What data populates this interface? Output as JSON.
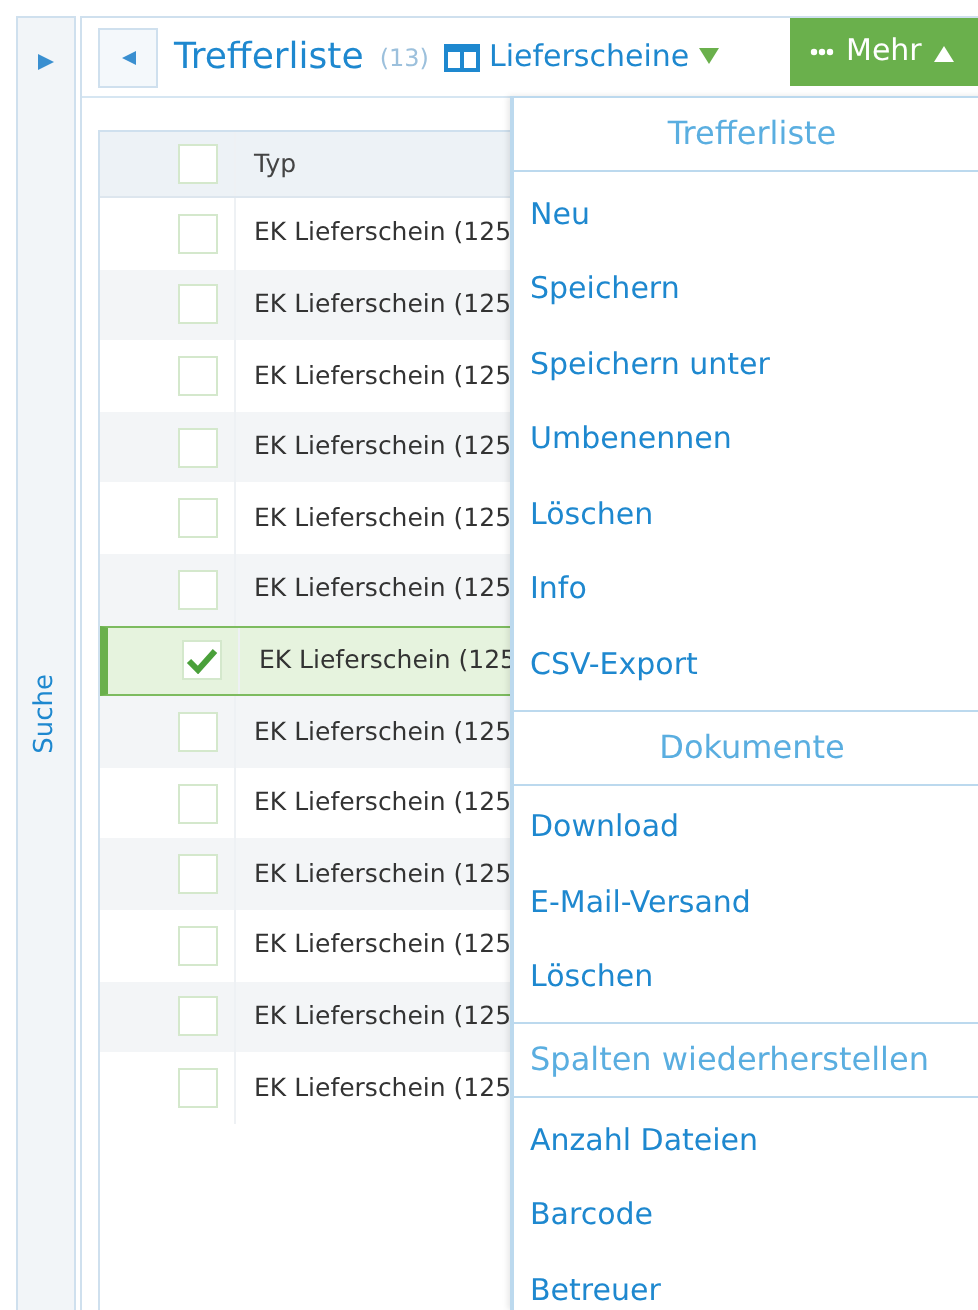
{
  "sidebar": {
    "label": "Suche"
  },
  "header": {
    "title": "Trefferliste",
    "count": "(13)",
    "view": "Lieferscheine",
    "more_button": "Mehr"
  },
  "table": {
    "columns": [
      "Typ"
    ],
    "header_checked": false,
    "rows": [
      {
        "typ": "EK Lieferschein (125",
        "selected": false
      },
      {
        "typ": "EK Lieferschein (125",
        "selected": false
      },
      {
        "typ": "EK Lieferschein (125",
        "selected": false
      },
      {
        "typ": "EK Lieferschein (125",
        "selected": false
      },
      {
        "typ": "EK Lieferschein (125",
        "selected": false
      },
      {
        "typ": "EK Lieferschein (125",
        "selected": false
      },
      {
        "typ": "EK Lieferschein (125",
        "selected": true
      },
      {
        "typ": "EK Lieferschein (125",
        "selected": false
      },
      {
        "typ": "EK Lieferschein (125",
        "selected": false
      },
      {
        "typ": "EK Lieferschein (125",
        "selected": false
      },
      {
        "typ": "EK Lieferschein (125",
        "selected": false
      },
      {
        "typ": "EK Lieferschein (125",
        "selected": false
      },
      {
        "typ": "EK Lieferschein (125",
        "selected": false
      }
    ]
  },
  "menu": {
    "sections": [
      {
        "title": "Trefferliste",
        "items": [
          "Neu",
          "Speichern",
          "Speichern unter",
          "Umbenennen",
          "Löschen",
          "Info",
          "CSV-Export"
        ]
      },
      {
        "title": "Dokumente",
        "items": [
          "Download",
          "E-Mail-Versand",
          "Löschen"
        ]
      },
      {
        "title": "Spalten wiederherstellen",
        "items": [
          "Anzahl Dateien",
          "Barcode",
          "Betreuer"
        ]
      }
    ]
  }
}
